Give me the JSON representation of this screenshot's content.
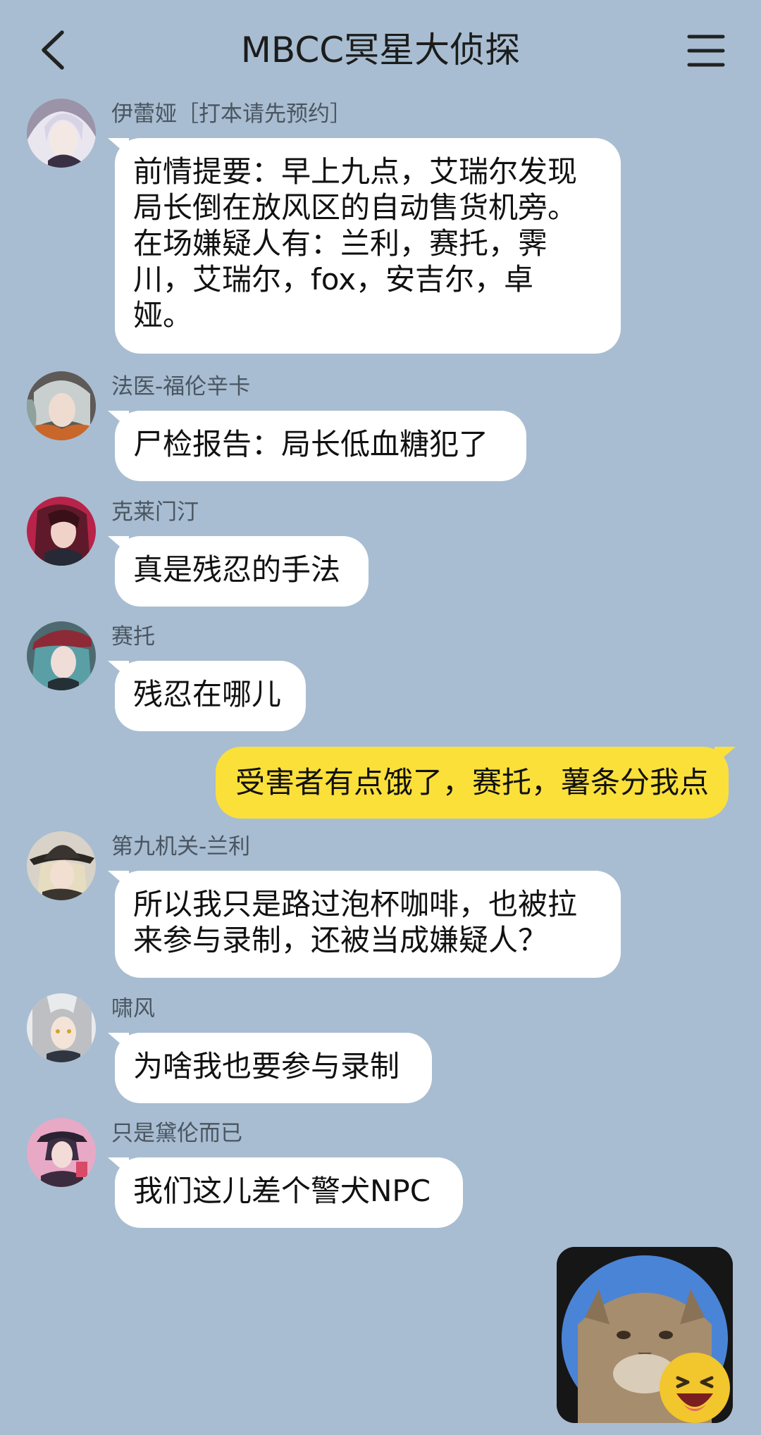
{
  "header": {
    "title": "MBCC冥星大侦探",
    "back_icon": "chevron-left-icon",
    "menu_icon": "hamburger-menu-icon"
  },
  "messages": [
    {
      "sender": "伊蕾娅［打本请先预约］",
      "text": "前情提要：早上九点，艾瑞尔发现\n局长倒在放风区的自动售货机旁。\n在场嫌疑人有：兰利，赛托，霁\n川，艾瑞尔，fox，安吉尔，卓\n娅。"
    },
    {
      "sender": "法医-福伦辛卡",
      "text": "尸检报告：局长低血糖犯了"
    },
    {
      "sender": "克莱门汀",
      "text": "真是残忍的手法"
    },
    {
      "sender": "赛托",
      "text": "残忍在哪儿"
    },
    {
      "sender": "第九机关-兰利",
      "text": "所以我只是路过泡杯咖啡，也被拉\n来参与录制，还被当成嫌疑人？"
    },
    {
      "sender": "啸风",
      "text": "为啥我也要参与录制"
    },
    {
      "sender": "只是黛伦而已",
      "text": "我们这儿差个警犬NPC"
    }
  ],
  "my_messages": [
    {
      "text": "受害者有点饿了，赛托，薯条分我点"
    }
  ],
  "sticker": {
    "name": "cat-laughing-sticker"
  },
  "colors": {
    "background": "#a8bdd1",
    "incoming_bubble": "#ffffff",
    "outgoing_bubble": "#fbe03a"
  }
}
